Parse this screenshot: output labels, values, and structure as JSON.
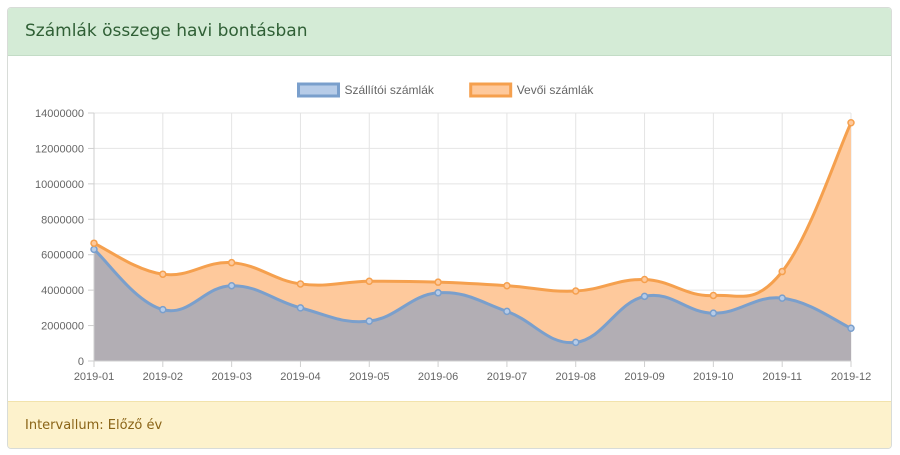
{
  "card": {
    "title": "Számlák összege havi bontásban",
    "footer": "Intervallum: Előző év"
  },
  "chart_data": {
    "type": "area",
    "categories": [
      "2019-01",
      "2019-02",
      "2019-03",
      "2019-04",
      "2019-05",
      "2019-06",
      "2019-07",
      "2019-08",
      "2019-09",
      "2019-10",
      "2019-11",
      "2019-12"
    ],
    "ylim": [
      0,
      14000000
    ],
    "yticks": [
      0,
      2000000,
      4000000,
      6000000,
      8000000,
      10000000,
      12000000,
      14000000
    ],
    "grid": true,
    "legend": "top-center",
    "series": [
      {
        "name": "Szállítói számlák",
        "values": [
          6300000,
          2900000,
          4250000,
          3000000,
          2250000,
          3850000,
          2800000,
          1050000,
          3650000,
          2700000,
          3550000,
          1850000
        ],
        "stroke": "#7a9fcc",
        "fill": "#b2aeb4",
        "legend_fill": "#b7cce8"
      },
      {
        "name": "Vevői számlák",
        "values": [
          6650000,
          4900000,
          5550000,
          4350000,
          4500000,
          4450000,
          4250000,
          3950000,
          4600000,
          3700000,
          5050000,
          13450000
        ],
        "stroke": "#f5a04e",
        "fill": "#fec99c",
        "legend_fill": "#fec99c"
      }
    ]
  }
}
